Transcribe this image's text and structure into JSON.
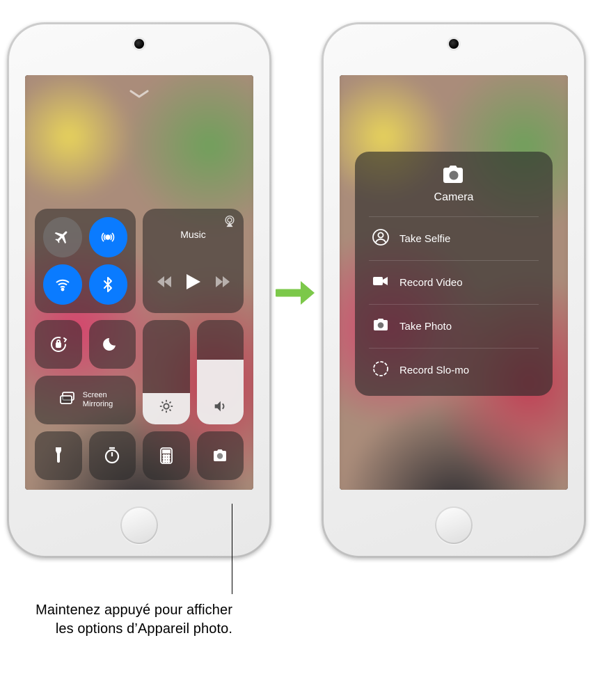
{
  "left": {
    "music_label": "Music",
    "screen_mirror_label": "Screen\nMirroring"
  },
  "camera_menu": {
    "title": "Camera",
    "items": [
      {
        "label": "Take Selfie"
      },
      {
        "label": "Record Video"
      },
      {
        "label": "Take Photo"
      },
      {
        "label": "Record Slo-mo"
      }
    ]
  },
  "callout": "Maintenez appuyé pour afficher les options d’Appareil photo."
}
